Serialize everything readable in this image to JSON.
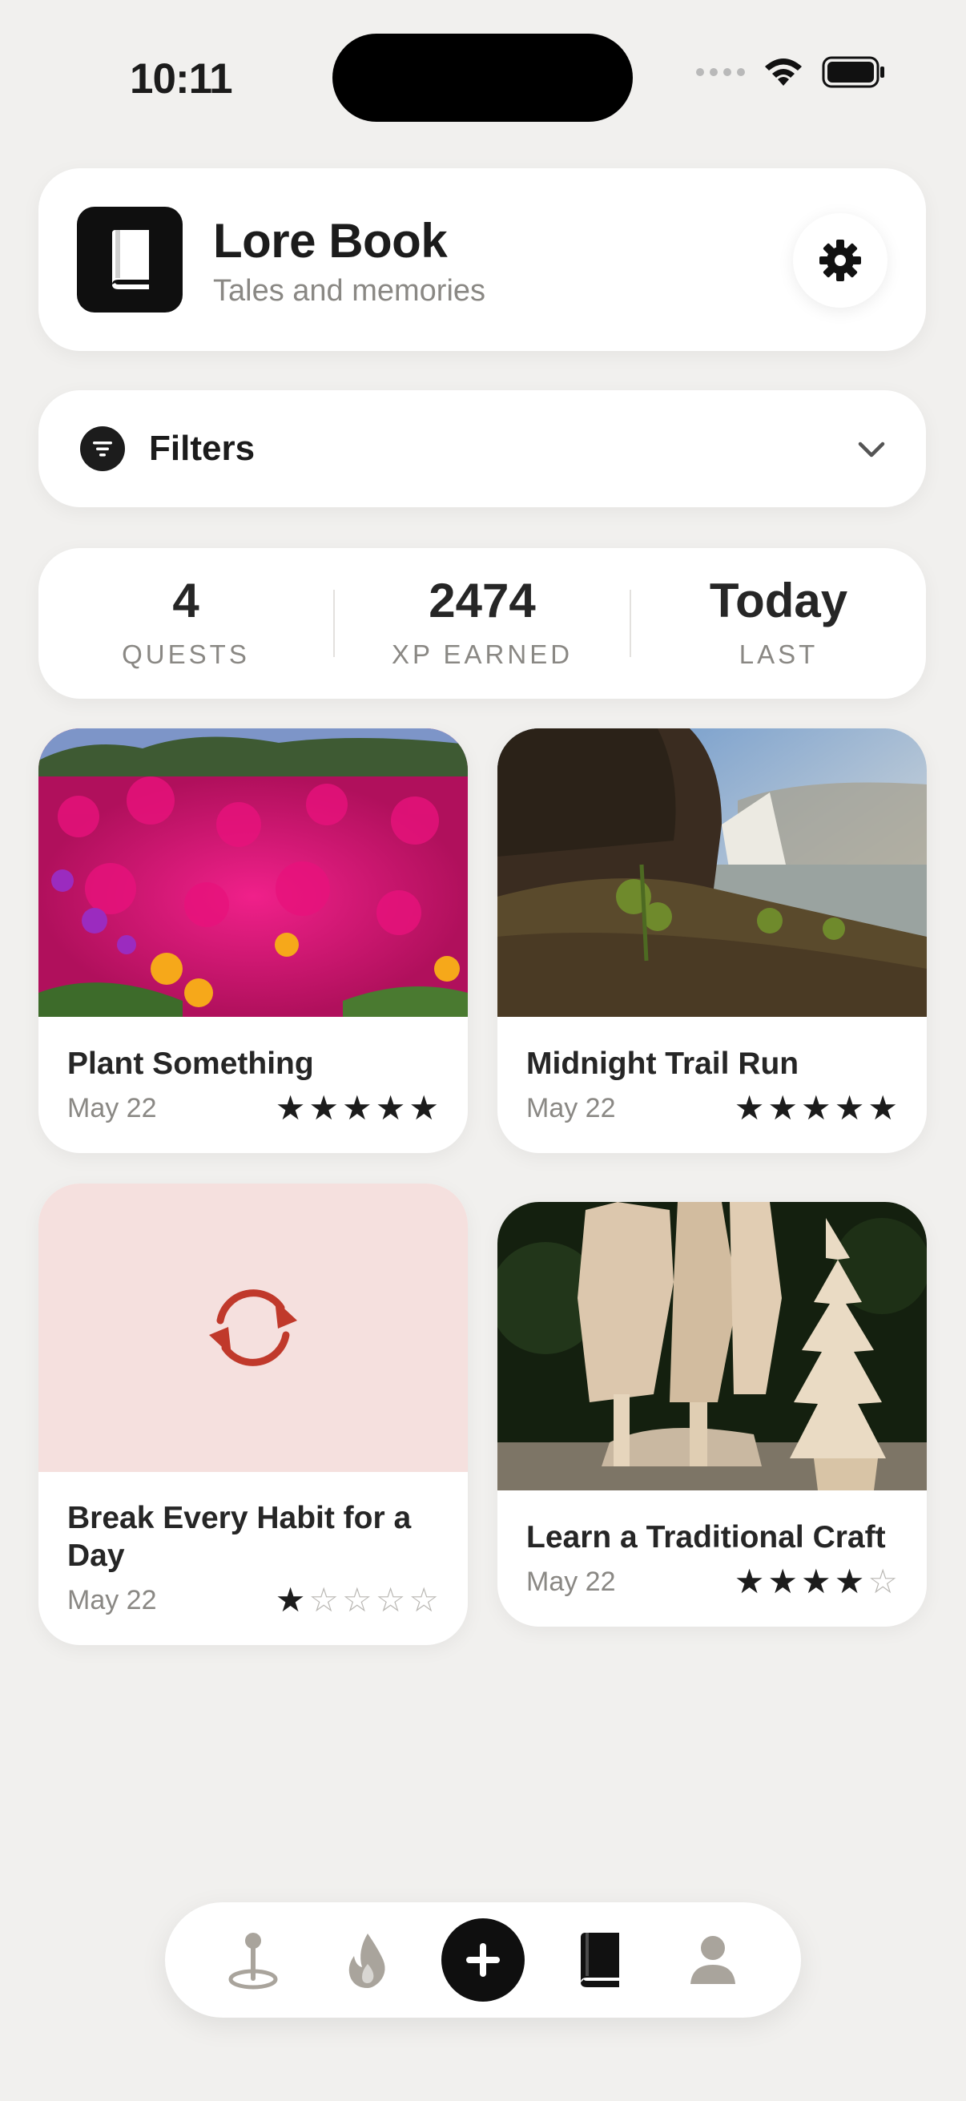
{
  "status_bar": {
    "time": "10:11"
  },
  "header": {
    "title": "Lore Book",
    "subtitle": "Tales and memories",
    "logo_icon": "book-icon",
    "settings_icon": "gear-icon"
  },
  "filters": {
    "label": "Filters",
    "icon": "filter-icon",
    "chevron": "chevron-down-icon"
  },
  "stats": [
    {
      "value": "4",
      "label": "QUESTS"
    },
    {
      "value": "2474",
      "label": "XP EARNED"
    },
    {
      "value": "Today",
      "label": "LAST"
    }
  ],
  "quests": [
    {
      "title": "Plant Something",
      "date": "May 22",
      "rating": 5,
      "max_rating": 5,
      "image": "magenta-flowers-photo"
    },
    {
      "title": "Midnight Trail Run",
      "date": "May 22",
      "rating": 5,
      "max_rating": 5,
      "image": "waterfall-cliff-photo"
    },
    {
      "title": "Break Every Habit for a Day",
      "date": "May 22",
      "rating": 1,
      "max_rating": 5,
      "image": "refresh-icon-placeholder"
    },
    {
      "title": "Learn a Traditional Craft",
      "date": "May 22",
      "rating": 4,
      "max_rating": 5,
      "image": "wood-carving-photo"
    }
  ],
  "nav": [
    {
      "icon": "map-pin-icon",
      "active": false
    },
    {
      "icon": "flame-icon",
      "active": false
    },
    {
      "icon": "plus-icon",
      "active": false
    },
    {
      "icon": "book-icon",
      "active": true
    },
    {
      "icon": "person-icon",
      "active": false
    }
  ],
  "colors": {
    "background": "#f1f0ee",
    "card": "#ffffff",
    "primary": "#0f0f0f",
    "muted_text": "#8a8884",
    "inactive_icon": "#a9a49c",
    "placeholder_bg": "#f5e0de",
    "placeholder_icon": "#c0392b"
  }
}
